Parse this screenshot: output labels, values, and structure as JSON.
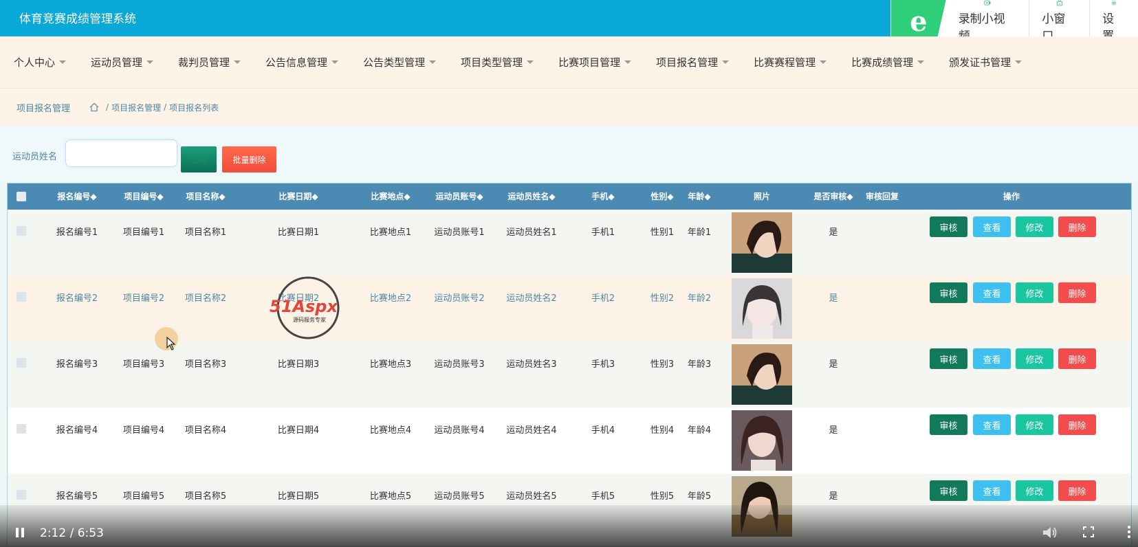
{
  "app": {
    "title": "体育竞赛成绩管理系统"
  },
  "toolbar": {
    "record_label": "录制小视频",
    "miniwindow_label": "小窗口",
    "settings_label": "设置"
  },
  "nav": {
    "items": [
      "个人中心",
      "运动员管理",
      "裁判员管理",
      "公告信息管理",
      "公告类型管理",
      "项目类型管理",
      "比赛项目管理",
      "项目报名管理",
      "比赛赛程管理",
      "比赛成绩管理",
      "颁发证书管理"
    ]
  },
  "breadcrumb": {
    "title": "项目报名管理",
    "items": [
      "项目报名管理",
      "项目报名列表"
    ],
    "separator": "/"
  },
  "search": {
    "label": "运动员姓名",
    "placeholder": "",
    "search_button": "查询",
    "batch_delete_button": "批量删除"
  },
  "table": {
    "headers": [
      "报名编号",
      "项目编号",
      "项目名称",
      "比赛日期",
      "比赛地点",
      "运动员账号",
      "运动员姓名",
      "手机",
      "性别",
      "年龄",
      "照片",
      "是否审核",
      "审核回复",
      "操作"
    ],
    "sort_glyph": "◆",
    "actions": [
      "审核",
      "查看",
      "修改",
      "删除"
    ],
    "rows": [
      {
        "id": "报名编号1",
        "item_no": "项目编号1",
        "item_name": "项目名称1",
        "date": "比赛日期1",
        "place": "比赛地点1",
        "account": "运动员账号1",
        "name": "运动员姓名1",
        "phone": "手机1",
        "gender": "性别1",
        "age": "年龄1",
        "reviewed": "是",
        "reply": ""
      },
      {
        "id": "报名编号2",
        "item_no": "项目编号2",
        "item_name": "项目名称2",
        "date": "比赛日期2",
        "place": "比赛地点2",
        "account": "运动员账号2",
        "name": "运动员姓名2",
        "phone": "手机2",
        "gender": "性别2",
        "age": "年龄2",
        "reviewed": "是",
        "reply": ""
      },
      {
        "id": "报名编号3",
        "item_no": "项目编号3",
        "item_name": "项目名称3",
        "date": "比赛日期3",
        "place": "比赛地点3",
        "account": "运动员账号3",
        "name": "运动员姓名3",
        "phone": "手机3",
        "gender": "性别3",
        "age": "年龄3",
        "reviewed": "是",
        "reply": ""
      },
      {
        "id": "报名编号4",
        "item_no": "项目编号4",
        "item_name": "项目名称4",
        "date": "比赛日期4",
        "place": "比赛地点4",
        "account": "运动员账号4",
        "name": "运动员姓名4",
        "phone": "手机4",
        "gender": "性别4",
        "age": "年龄4",
        "reviewed": "是",
        "reply": ""
      },
      {
        "id": "报名编号5",
        "item_no": "项目编号5",
        "item_name": "项目名称5",
        "date": "比赛日期5",
        "place": "比赛地点5",
        "account": "运动员账号5",
        "name": "运动员姓名5",
        "phone": "手机5",
        "gender": "性别5",
        "age": "年龄5",
        "reviewed": "是",
        "reply": ""
      }
    ]
  },
  "watermark": {
    "brand": "51Aspx",
    "tagline": "源码服务专家"
  },
  "video": {
    "time": "2:12 / 6:53",
    "progress": 0.321
  },
  "colors": {
    "header": "#08a9d8",
    "table_header": "#4b8ab2",
    "audit": "#127a5b",
    "view": "#3dc0f0",
    "edit": "#18c6a0",
    "delete": "#f24c4c"
  },
  "icons": [
    "record-video-icon",
    "mini-window-icon",
    "gear-icon",
    "home-icon",
    "pause-icon",
    "volume-icon",
    "fullscreen-icon",
    "more-vertical-icon",
    "cursor-icon"
  ]
}
